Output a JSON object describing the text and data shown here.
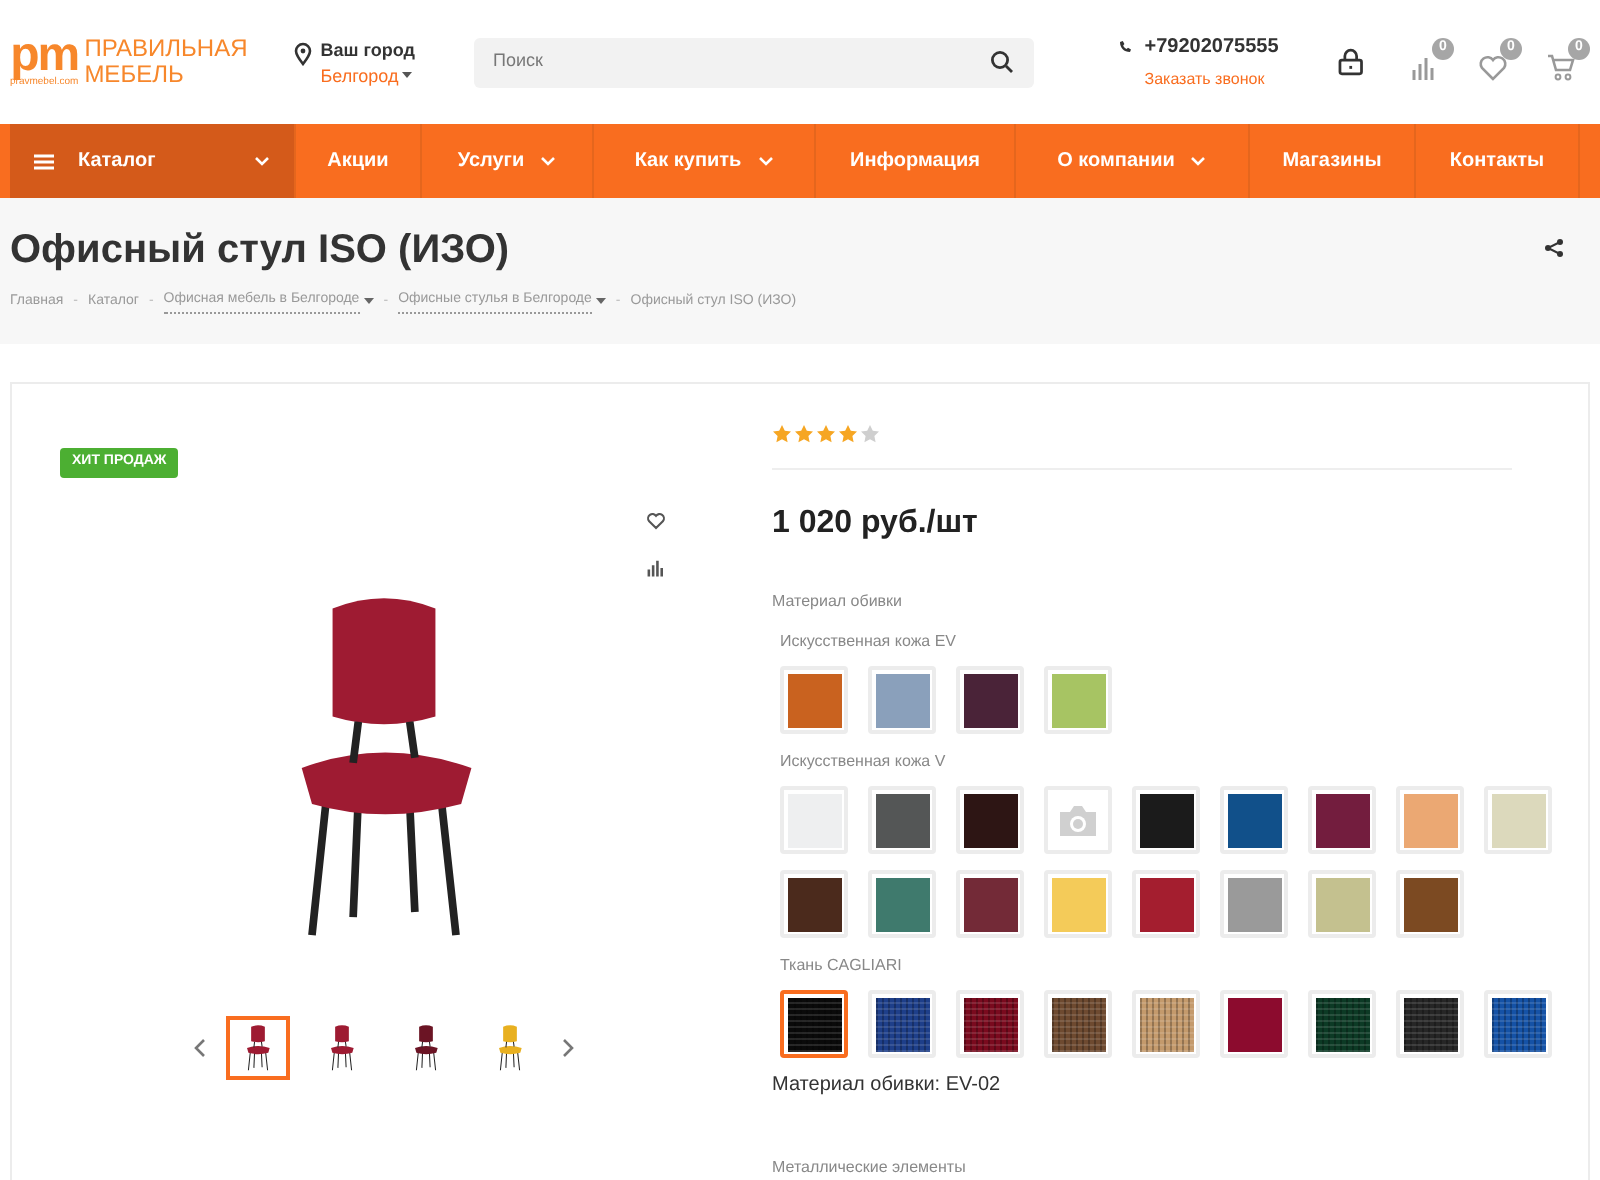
{
  "logo": {
    "mark": "pm",
    "site": "pravmebel.com",
    "name_line1": "ПРАВИЛЬНАЯ",
    "name_line2": "МЕБЕЛЬ"
  },
  "city": {
    "label": "Ваш город",
    "value": "Белгород"
  },
  "search": {
    "placeholder": "Поиск"
  },
  "contact": {
    "phone": "+79202075555",
    "callback": "Заказать звонок"
  },
  "counters": [
    {
      "kind": "compare",
      "count": "0"
    },
    {
      "kind": "favorites",
      "count": "0"
    },
    {
      "kind": "cart",
      "count": "0"
    }
  ],
  "nav": [
    {
      "label": "Каталог",
      "dropdown": true,
      "selected": true
    },
    {
      "label": "Акции",
      "dropdown": false,
      "selected": false
    },
    {
      "label": "Услуги",
      "dropdown": true,
      "selected": false
    },
    {
      "label": "Как купить",
      "dropdown": true,
      "selected": false
    },
    {
      "label": "Информация",
      "dropdown": false,
      "selected": false
    },
    {
      "label": "О компании",
      "dropdown": true,
      "selected": false
    },
    {
      "label": "Магазины",
      "dropdown": false,
      "selected": false
    },
    {
      "label": "Контакты",
      "dropdown": false,
      "selected": false
    }
  ],
  "page": {
    "title": "Офисный стул ISO (ИЗО)"
  },
  "breadcrumb_separator": "-",
  "breadcrumbs": [
    {
      "label": "Главная",
      "dropdown": false
    },
    {
      "label": "Каталог",
      "dropdown": false
    },
    {
      "label": "Офисная мебель в Белгороде",
      "dropdown": true
    },
    {
      "label": "Офисные стулья в Белгороде",
      "dropdown": true
    },
    {
      "label": "Офисный стул ISO (ИЗО)",
      "dropdown": false
    }
  ],
  "product": {
    "badge": "ХИТ ПРОДАЖ",
    "stars": 4,
    "price": "1 020 руб./шт",
    "thumbnails": [
      {
        "color": "#9e1b32",
        "selected": true
      },
      {
        "color": "#9e1b32",
        "selected": false
      },
      {
        "color": "#6b1424",
        "selected": false
      },
      {
        "color": "#e8b020",
        "selected": false
      }
    ],
    "material_label": "Материал обивки",
    "groups": [
      {
        "title": "Искусственная кожа EV",
        "swatches": [
          {
            "kind": "color",
            "color": "#c9621f",
            "selected": false
          },
          {
            "kind": "color",
            "color": "#8aa0bb",
            "selected": false
          },
          {
            "kind": "color",
            "color": "#4a2338",
            "selected": false
          },
          {
            "kind": "color",
            "color": "#a7c463",
            "selected": false
          }
        ]
      },
      {
        "title": "Искусственная кожа V",
        "swatches": [
          {
            "kind": "color",
            "color": "#eeeff0",
            "selected": false
          },
          {
            "kind": "color",
            "color": "#545656",
            "selected": false
          },
          {
            "kind": "color",
            "color": "#2d1514",
            "selected": false
          },
          {
            "kind": "no-image",
            "selected": false
          },
          {
            "kind": "color",
            "color": "#1b1b1b",
            "selected": false
          },
          {
            "kind": "color",
            "color": "#11508a",
            "selected": false
          },
          {
            "kind": "color",
            "color": "#731d3e",
            "selected": false
          },
          {
            "kind": "color",
            "color": "#eba873",
            "selected": false
          },
          {
            "kind": "color",
            "color": "#dcd9bc",
            "selected": false
          },
          {
            "kind": "color",
            "color": "#4b2a1c",
            "selected": false
          },
          {
            "kind": "color",
            "color": "#3f7a6d",
            "selected": false
          },
          {
            "kind": "color",
            "color": "#732a37",
            "selected": false
          },
          {
            "kind": "color",
            "color": "#f4cb59",
            "selected": false
          },
          {
            "kind": "color",
            "color": "#a41e2f",
            "selected": false
          },
          {
            "kind": "color",
            "color": "#9a9a9a",
            "selected": false
          },
          {
            "kind": "color",
            "color": "#c4c18f",
            "selected": false
          },
          {
            "kind": "color",
            "color": "#7c4a22",
            "selected": false
          }
        ]
      },
      {
        "title": "Ткань CAGLIARI",
        "swatches": [
          {
            "kind": "fabric",
            "color": "#0a0a0a",
            "selected": true
          },
          {
            "kind": "fabric",
            "color": "#1e3f8a",
            "selected": false
          },
          {
            "kind": "fabric",
            "color": "#7a0a1e",
            "selected": false
          },
          {
            "kind": "fabric",
            "color": "#6e4a30",
            "selected": false
          },
          {
            "kind": "fabric",
            "color": "#c49a6c",
            "selected": false
          },
          {
            "kind": "color",
            "color": "#8c0b2e",
            "selected": false
          },
          {
            "kind": "fabric",
            "color": "#0c3a25",
            "selected": false
          },
          {
            "kind": "fabric",
            "color": "#262626",
            "selected": false
          },
          {
            "kind": "fabric",
            "color": "#1552a6",
            "selected": false
          }
        ]
      }
    ],
    "chosen": "Материал обивки: EV-02",
    "next_section": "Металлические элементы"
  }
}
